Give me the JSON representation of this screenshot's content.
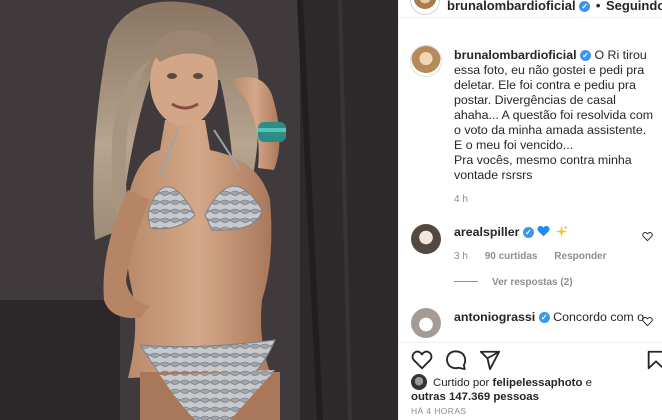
{
  "post": {
    "author": "brunalombardioficial",
    "follow_status": "Seguindo",
    "separator": "•",
    "verified_mark": "✓"
  },
  "caption": {
    "author": "brunalombardioficial",
    "text": "O Ri tirou essa foto, eu não gostei e pedi pra deletar. Ele foi contra e pediu pra postar. Divergências de casal ahaha... A questão foi resolvida com o voto da minha amada assistente. E o meu foi vencido...",
    "tail": "Pra vocês, mesmo contra minha vontade rsrsrs",
    "time": "4 h"
  },
  "comments": [
    {
      "author": "arealspiller",
      "emoji": [
        "blue-heart-icon",
        "sparkle-icon"
      ],
      "time": "3 h",
      "likes": "90 curtidas",
      "reply_label": "Responder",
      "view_replies": "Ver respostas (2)"
    },
    {
      "author": "antoniograssi",
      "text": "Concordo com o"
    }
  ],
  "actions": {
    "icons": [
      "heart-icon",
      "comment-icon",
      "share-icon",
      "save-icon"
    ]
  },
  "likes": {
    "prefix": "Curtido por",
    "liked_by": "felipelessaphoto",
    "conjunction": "e",
    "others": "outras 147.369 pessoas"
  },
  "timestamp": "HÁ 4 HORAS",
  "colors": {
    "verified": "#3897f0",
    "text": "#262626",
    "muted": "#8e8e8e",
    "border": "#efefef"
  }
}
